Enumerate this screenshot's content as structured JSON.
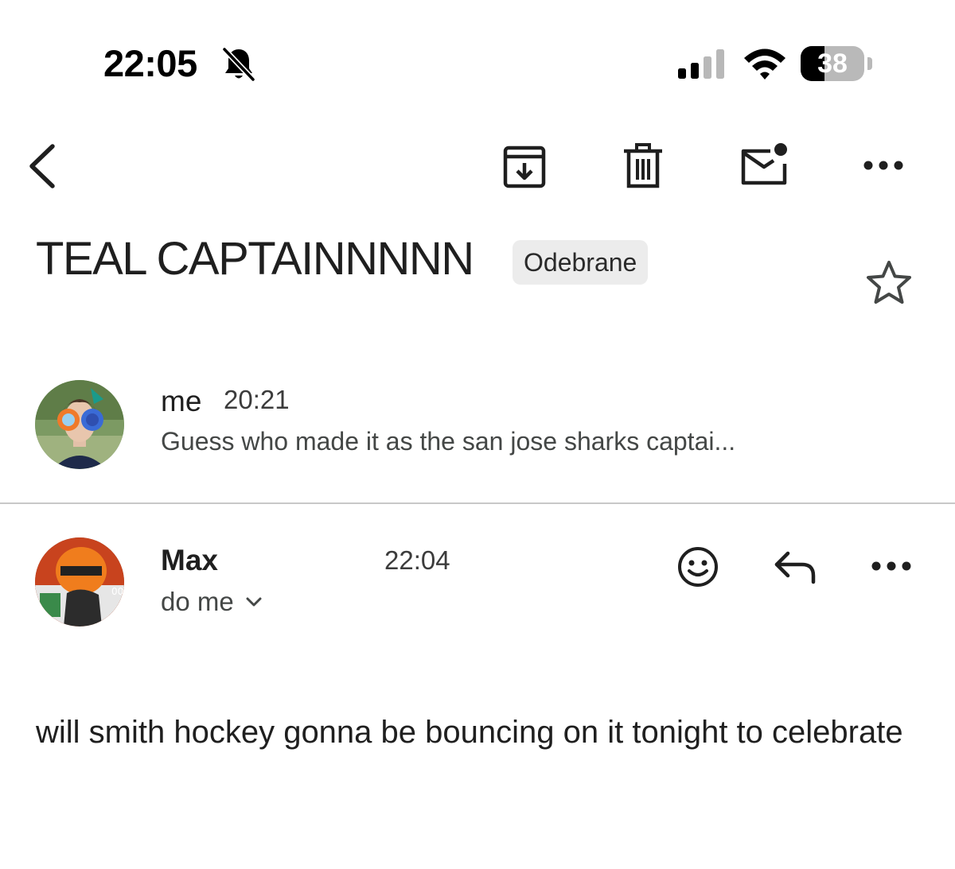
{
  "status_bar": {
    "time": "22:05",
    "silent_icon": "bell-slash-icon",
    "signal_icon": "cellular-signal-icon",
    "wifi_icon": "wifi-icon",
    "battery_level": "38",
    "battery_fraction": 0.38
  },
  "toolbar": {
    "back_icon": "chevron-left-icon",
    "archive_icon": "archive-icon",
    "delete_icon": "trash-icon",
    "unread_icon": "mark-unread-icon",
    "more_icon": "more-horizontal-icon"
  },
  "thread": {
    "subject": "TEAL CAPTAINNNNN",
    "label": "Odebrane",
    "star_icon": "star-outline-icon"
  },
  "messages": [
    {
      "sender": "me",
      "time": "20:21",
      "snippet": "Guess who made it as the san jose sharks captai..."
    },
    {
      "sender": "Max",
      "time": "22:04",
      "recipient": "do me",
      "recipient_expand_icon": "chevron-down-icon",
      "actions": {
        "react_icon": "smiley-icon",
        "reply_icon": "reply-icon",
        "more_icon": "more-horizontal-icon"
      },
      "body": "will smith hockey gonna be bouncing on it tonight to celebrate"
    }
  ],
  "colors": {
    "text_primary": "#1f1f1f",
    "text_secondary": "#444746",
    "chip_bg": "#ececec",
    "divider": "#c8c8c8"
  }
}
